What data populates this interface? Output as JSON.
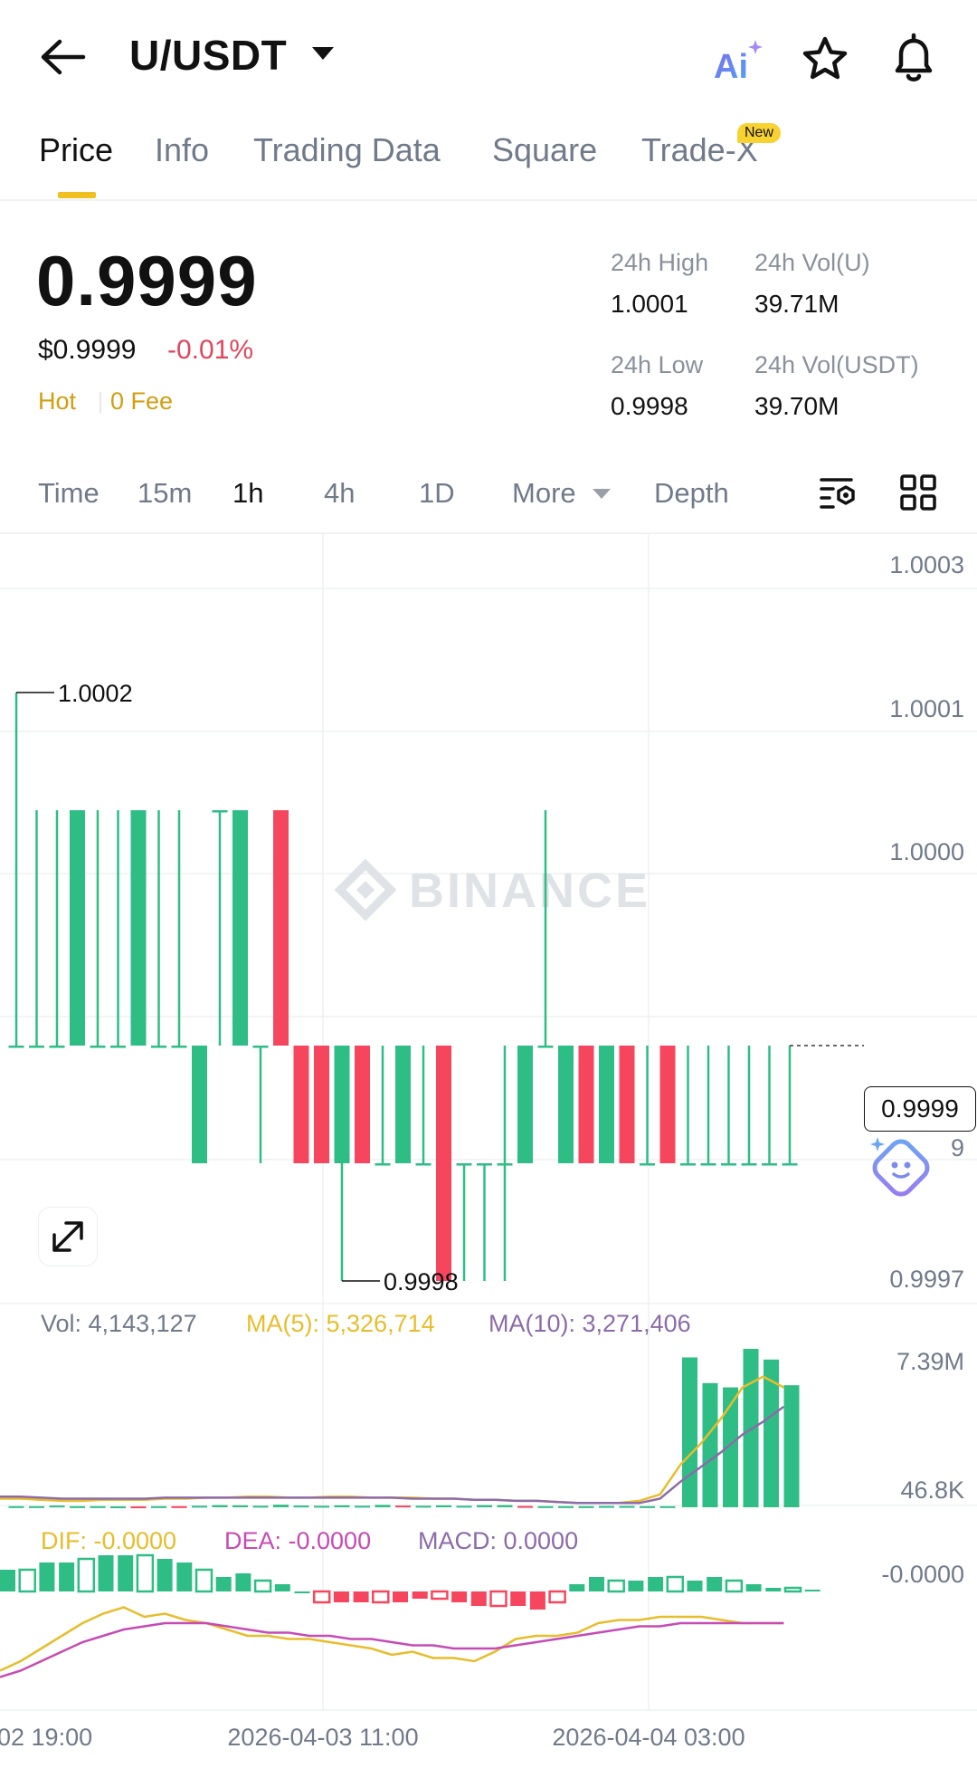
{
  "header": {
    "pair": "U/USDT",
    "ai_label": "Ai"
  },
  "tabs": [
    {
      "label": "Price",
      "active": true
    },
    {
      "label": "Info"
    },
    {
      "label": "Trading Data"
    },
    {
      "label": "Square"
    },
    {
      "label": "Trade-X",
      "badge": "New"
    }
  ],
  "ticker": {
    "last_price": "0.9999",
    "usd_price": "$0.9999",
    "change_pct": "-0.01%",
    "tag_hot": "Hot",
    "tag_fee": "0 Fee",
    "high_label": "24h High",
    "high_value": "1.0001",
    "vol_base_label": "24h Vol(U)",
    "vol_base_value": "39.71M",
    "low_label": "24h Low",
    "low_value": "0.9998",
    "vol_quote_label": "24h Vol(USDT)",
    "vol_quote_value": "39.70M"
  },
  "intervals": {
    "time": "Time",
    "m15": "15m",
    "h1": "1h",
    "h4": "4h",
    "d1": "1D",
    "more": "More",
    "depth": "Depth",
    "active": "1h"
  },
  "colors": {
    "up": "#2ebd85",
    "down": "#f6465d",
    "accent": "#f0b90b",
    "ma5": "#e7bd2c",
    "ma10": "#8c6ba8",
    "dif": "#e7bd2c",
    "dea": "#c64bb4",
    "macd": "#8c6ba8"
  },
  "chart_data": {
    "type": "candlestick",
    "watermark": "BINANCE",
    "price_axis": {
      "ticks": [
        "1.0003",
        "1.0001",
        "1.0000",
        "0.9997"
      ],
      "partial_tick": "9",
      "range": [
        0.99965,
        1.00035
      ]
    },
    "time_axis": [
      "02 19:00",
      "2026-04-03 11:00",
      "2026-04-04 03:00"
    ],
    "current_price": "0.9999",
    "high_marker": "1.0002",
    "low_marker": "0.9998",
    "candles": [
      {
        "o": 0.9999,
        "h": 1.0002,
        "l": 0.9999,
        "c": 0.9999
      },
      {
        "o": 0.9999,
        "h": 1.0001,
        "l": 0.9999,
        "c": 0.9999
      },
      {
        "o": 0.9999,
        "h": 1.0001,
        "l": 0.9999,
        "c": 0.9999
      },
      {
        "o": 0.9999,
        "h": 1.0001,
        "l": 0.9999,
        "c": 1.0001
      },
      {
        "o": 0.9999,
        "h": 1.0001,
        "l": 0.9999,
        "c": 0.9999
      },
      {
        "o": 0.9999,
        "h": 1.0001,
        "l": 0.9999,
        "c": 0.9999
      },
      {
        "o": 0.9999,
        "h": 1.0001,
        "l": 0.9999,
        "c": 1.0001
      },
      {
        "o": 0.9999,
        "h": 1.0001,
        "l": 0.9999,
        "c": 0.9999
      },
      {
        "o": 0.9999,
        "h": 1.0001,
        "l": 0.9999,
        "c": 0.9999
      },
      {
        "o": 0.9998,
        "h": 0.9999,
        "l": 0.9998,
        "c": 0.9999
      },
      {
        "o": 1.0001,
        "h": 1.0001,
        "l": 0.9999,
        "c": 1.0001
      },
      {
        "o": 0.9999,
        "h": 1.0001,
        "l": 0.9999,
        "c": 1.0001
      },
      {
        "o": 0.9999,
        "h": 0.9999,
        "l": 0.9998,
        "c": 0.9999
      },
      {
        "o": 1.0001,
        "h": 1.0001,
        "l": 0.9999,
        "c": 0.9999
      },
      {
        "o": 0.9999,
        "h": 0.9999,
        "l": 0.9998,
        "c": 0.9998
      },
      {
        "o": 0.9999,
        "h": 0.9999,
        "l": 0.9998,
        "c": 0.9998
      },
      {
        "o": 0.9998,
        "h": 0.9999,
        "l": 0.9997,
        "c": 0.9999
      },
      {
        "o": 0.9999,
        "h": 0.9999,
        "l": 0.9998,
        "c": 0.9998
      },
      {
        "o": 0.9998,
        "h": 0.9999,
        "l": 0.9998,
        "c": 0.9998
      },
      {
        "o": 0.9998,
        "h": 0.9999,
        "l": 0.9998,
        "c": 0.9999
      },
      {
        "o": 0.9998,
        "h": 0.9999,
        "l": 0.9998,
        "c": 0.9998
      },
      {
        "o": 0.9999,
        "h": 0.9999,
        "l": 0.9997,
        "c": 0.9997
      },
      {
        "o": 0.9998,
        "h": 0.9998,
        "l": 0.9997,
        "c": 0.9998
      },
      {
        "o": 0.9998,
        "h": 0.9998,
        "l": 0.9997,
        "c": 0.9998
      },
      {
        "o": 0.9998,
        "h": 0.9999,
        "l": 0.9997,
        "c": 0.9998
      },
      {
        "o": 0.9998,
        "h": 0.9999,
        "l": 0.9998,
        "c": 0.9999
      },
      {
        "o": 0.9999,
        "h": 1.0001,
        "l": 0.9999,
        "c": 0.9999
      },
      {
        "o": 0.9998,
        "h": 0.9999,
        "l": 0.9998,
        "c": 0.9999
      },
      {
        "o": 0.9999,
        "h": 0.9999,
        "l": 0.9998,
        "c": 0.9998
      },
      {
        "o": 0.9998,
        "h": 0.9999,
        "l": 0.9998,
        "c": 0.9999
      },
      {
        "o": 0.9999,
        "h": 0.9999,
        "l": 0.9998,
        "c": 0.9998
      },
      {
        "o": 0.9998,
        "h": 0.9999,
        "l": 0.9998,
        "c": 0.9998
      },
      {
        "o": 0.9999,
        "h": 0.9999,
        "l": 0.9998,
        "c": 0.9998
      },
      {
        "o": 0.9998,
        "h": 0.9999,
        "l": 0.9998,
        "c": 0.9998
      },
      {
        "o": 0.9998,
        "h": 0.9999,
        "l": 0.9998,
        "c": 0.9998
      },
      {
        "o": 0.9998,
        "h": 0.9999,
        "l": 0.9998,
        "c": 0.9998
      },
      {
        "o": 0.9998,
        "h": 0.9999,
        "l": 0.9998,
        "c": 0.9998
      },
      {
        "o": 0.9998,
        "h": 0.9999,
        "l": 0.9998,
        "c": 0.9998
      },
      {
        "o": 0.9998,
        "h": 0.9999,
        "l": 0.9998,
        "c": 0.9998
      }
    ],
    "volume": {
      "label": "Vol: 4,143,127",
      "ma5_label": "MA(5): 5,326,714",
      "ma10_label": "MA(10): 3,271,406",
      "ticks": [
        "7.39M",
        "46.8K"
      ],
      "bars": [
        0.05,
        0.05,
        0.08,
        0.05,
        0.05,
        0.04,
        0.04,
        0.05,
        0.05,
        0.07,
        0.1,
        0.09,
        0.07,
        0.12,
        0.08,
        0.07,
        0.09,
        0.07,
        0.11,
        0.08,
        0.07,
        0.09,
        0.07,
        0.1,
        0.1,
        0.06,
        0.05,
        0.05,
        0.05,
        0.06,
        0.06,
        0.05,
        0.05,
        7.0,
        5.8,
        5.6,
        7.4,
        6.9,
        5.7
      ],
      "bar_colors": [
        "up",
        "up",
        "up",
        "up",
        "up",
        "up",
        "down",
        "up",
        "down",
        "up",
        "up",
        "up",
        "up",
        "up",
        "up",
        "up",
        "up",
        "up",
        "up",
        "down",
        "up",
        "up",
        "up",
        "up",
        "up",
        "down",
        "up",
        "up",
        "up",
        "up",
        "up",
        "up",
        "up",
        "up",
        "up",
        "up",
        "up",
        "up",
        "up"
      ],
      "ma5": [
        0.4,
        0.4,
        0.35,
        0.3,
        0.3,
        0.35,
        0.35,
        0.35,
        0.4,
        0.4,
        0.45,
        0.45,
        0.5,
        0.5,
        0.45,
        0.45,
        0.5,
        0.5,
        0.45,
        0.45,
        0.45,
        0.4,
        0.4,
        0.35,
        0.35,
        0.3,
        0.3,
        0.25,
        0.2,
        0.2,
        0.2,
        0.3,
        0.6,
        2.0,
        3.0,
        4.2,
        5.6,
        6.1,
        5.6
      ],
      "ma10": [
        0.5,
        0.5,
        0.45,
        0.4,
        0.4,
        0.4,
        0.4,
        0.4,
        0.45,
        0.45,
        0.45,
        0.45,
        0.45,
        0.45,
        0.45,
        0.45,
        0.45,
        0.45,
        0.45,
        0.45,
        0.4,
        0.4,
        0.4,
        0.35,
        0.35,
        0.3,
        0.3,
        0.25,
        0.2,
        0.2,
        0.2,
        0.2,
        0.4,
        1.2,
        1.9,
        2.6,
        3.4,
        4.0,
        4.7
      ]
    },
    "macd": {
      "dif_label": "DIF: -0.0000",
      "dea_label": "DEA: -0.0000",
      "macd_label": "MACD: 0.0000",
      "tick": "-0.0000",
      "hist": [
        0.6,
        0.6,
        0.8,
        0.8,
        0.9,
        1.0,
        1.0,
        1.0,
        0.9,
        0.8,
        0.6,
        0.4,
        0.5,
        0.3,
        0.2,
        0.0,
        -0.3,
        -0.3,
        -0.3,
        -0.3,
        -0.3,
        -0.2,
        -0.2,
        -0.3,
        -0.4,
        -0.4,
        -0.4,
        -0.5,
        -0.3,
        0.2,
        0.4,
        0.3,
        0.3,
        0.4,
        0.4,
        0.3,
        0.4,
        0.3,
        0.2,
        0.1,
        0.1,
        0.05
      ],
      "dif": [
        -1.3,
        -1.0,
        -0.6,
        -0.2,
        0.2,
        0.5,
        0.7,
        0.4,
        0.5,
        0.3,
        0.2,
        0.0,
        -0.2,
        -0.2,
        -0.3,
        -0.3,
        -0.4,
        -0.5,
        -0.6,
        -0.8,
        -0.7,
        -0.9,
        -0.9,
        -1.0,
        -0.7,
        -0.3,
        -0.2,
        -0.2,
        -0.1,
        0.2,
        0.3,
        0.3,
        0.4,
        0.4,
        0.4,
        0.3,
        0.2,
        0.2,
        0.2
      ],
      "dea": [
        -1.5,
        -1.3,
        -1.0,
        -0.7,
        -0.4,
        -0.2,
        0.0,
        0.1,
        0.2,
        0.2,
        0.2,
        0.1,
        0.0,
        -0.1,
        -0.1,
        -0.2,
        -0.2,
        -0.3,
        -0.3,
        -0.4,
        -0.5,
        -0.5,
        -0.6,
        -0.6,
        -0.6,
        -0.5,
        -0.4,
        -0.3,
        -0.2,
        -0.1,
        0.0,
        0.1,
        0.1,
        0.2,
        0.2,
        0.2,
        0.2,
        0.2,
        0.2
      ]
    }
  }
}
